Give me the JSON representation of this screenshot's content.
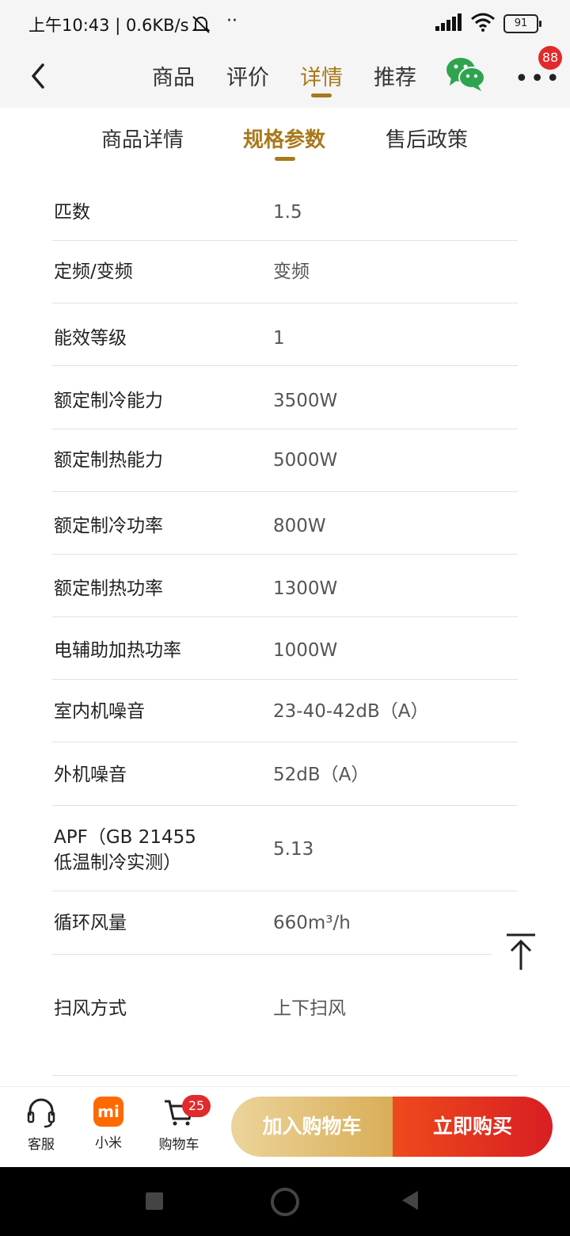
{
  "status_bar": {
    "time_speed": "上午10:43 | 0.6KB/s",
    "battery": "91"
  },
  "top_nav": {
    "tabs": [
      {
        "label": "商品"
      },
      {
        "label": "评价"
      },
      {
        "label": "详情"
      },
      {
        "label": "推荐"
      }
    ],
    "active_tab": "详情",
    "more_badge": "88"
  },
  "sub_tabs": [
    {
      "label": "商品详情"
    },
    {
      "label": "规格参数"
    },
    {
      "label": "售后政策"
    }
  ],
  "specs": [
    {
      "label": "匹数",
      "value": "1.5"
    },
    {
      "label": "定频/变频",
      "value": "变频"
    },
    {
      "label": "能效等级",
      "value": "1"
    },
    {
      "label": "额定制冷能力",
      "value": "3500W"
    },
    {
      "label": "额定制热能力",
      "value": "5000W"
    },
    {
      "label": "额定制冷功率",
      "value": "800W"
    },
    {
      "label": "额定制热功率",
      "value": "1300W"
    },
    {
      "label": "电辅助加热功率",
      "value": "1000W"
    },
    {
      "label": "室内机噪音",
      "value": "23-40-42dB（A）"
    },
    {
      "label": "外机噪音",
      "value": "52dB（A）"
    },
    {
      "label": "APF（GB 21455",
      "label2": "低温制冷实测）",
      "value": "5.13"
    },
    {
      "label": "循环风量",
      "value": "660m³/h"
    },
    {
      "label": "扫风方式",
      "value": "上下扫风"
    }
  ],
  "bottom_bar": {
    "service_label": "客服",
    "mi_label": "小米",
    "mi_logo_text": "mi",
    "cart_label": "购物车",
    "cart_count": "25",
    "add_to_cart": "加入购物车",
    "buy_now": "立即购买"
  }
}
